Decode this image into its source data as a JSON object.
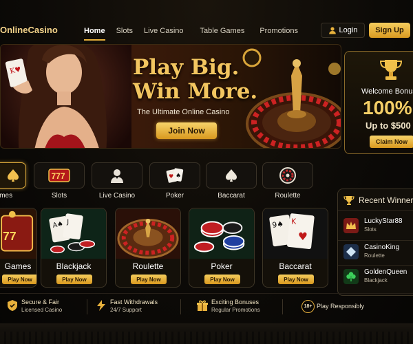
{
  "header": {
    "logo": "OnlineCasino",
    "nav": [
      "Home",
      "Slots",
      "Live Casino",
      "Table Games",
      "Promotions"
    ],
    "login": "Login",
    "signup": "Sign Up"
  },
  "hero": {
    "title_line1": "Play Big.",
    "title_line2": "Win More.",
    "subtitle": "The Ultimate Online Casino",
    "cta": "Join Now"
  },
  "bonus": {
    "title": "Welcome Bonus",
    "percent": "100%",
    "upto": "Up to $500",
    "cta": "Claim Now"
  },
  "categories": [
    {
      "label": "Games",
      "icon": "spade-icon"
    },
    {
      "label": "Slots",
      "icon": "slot-777-icon"
    },
    {
      "label": "Live Casino",
      "icon": "dealer-icon"
    },
    {
      "label": "Poker",
      "icon": "cards-icon"
    },
    {
      "label": "Baccarat",
      "icon": "spade-icon"
    },
    {
      "label": "Roulette",
      "icon": "roulette-icon"
    }
  ],
  "games": [
    {
      "title": "Games",
      "cta": "Play Now"
    },
    {
      "title": "Blackjack",
      "cta": "Play Now"
    },
    {
      "title": "Roulette",
      "cta": "Play Now"
    },
    {
      "title": "Poker",
      "cta": "Play Now"
    },
    {
      "title": "Baccarat",
      "cta": "Play Now"
    }
  ],
  "winners": {
    "title": "Recent Winners",
    "items": [
      {
        "name": "LuckyStar88",
        "game": "Slots",
        "icon": "crown-icon"
      },
      {
        "name": "CasinoKing",
        "game": "Roulette",
        "icon": "diamond-icon"
      },
      {
        "name": "GoldenQueen",
        "game": "Blackjack",
        "icon": "clover-icon"
      }
    ]
  },
  "features": [
    {
      "title": "Secure & Fair",
      "sub": "Licensed Casino",
      "icon": "shield-icon"
    },
    {
      "title": "Fast Withdrawals",
      "sub": "24/7 Support",
      "icon": "lightning-icon"
    },
    {
      "title": "Exciting Bonuses",
      "sub": "Regular Promotions",
      "icon": "gift-icon"
    },
    {
      "title": "Play Responsibly",
      "sub": "",
      "icon": "age-18-icon",
      "badge": "18+"
    }
  ],
  "colors": {
    "accent": "#e8b13c",
    "gold_text": "#f3c660",
    "background": "#0b0906"
  }
}
